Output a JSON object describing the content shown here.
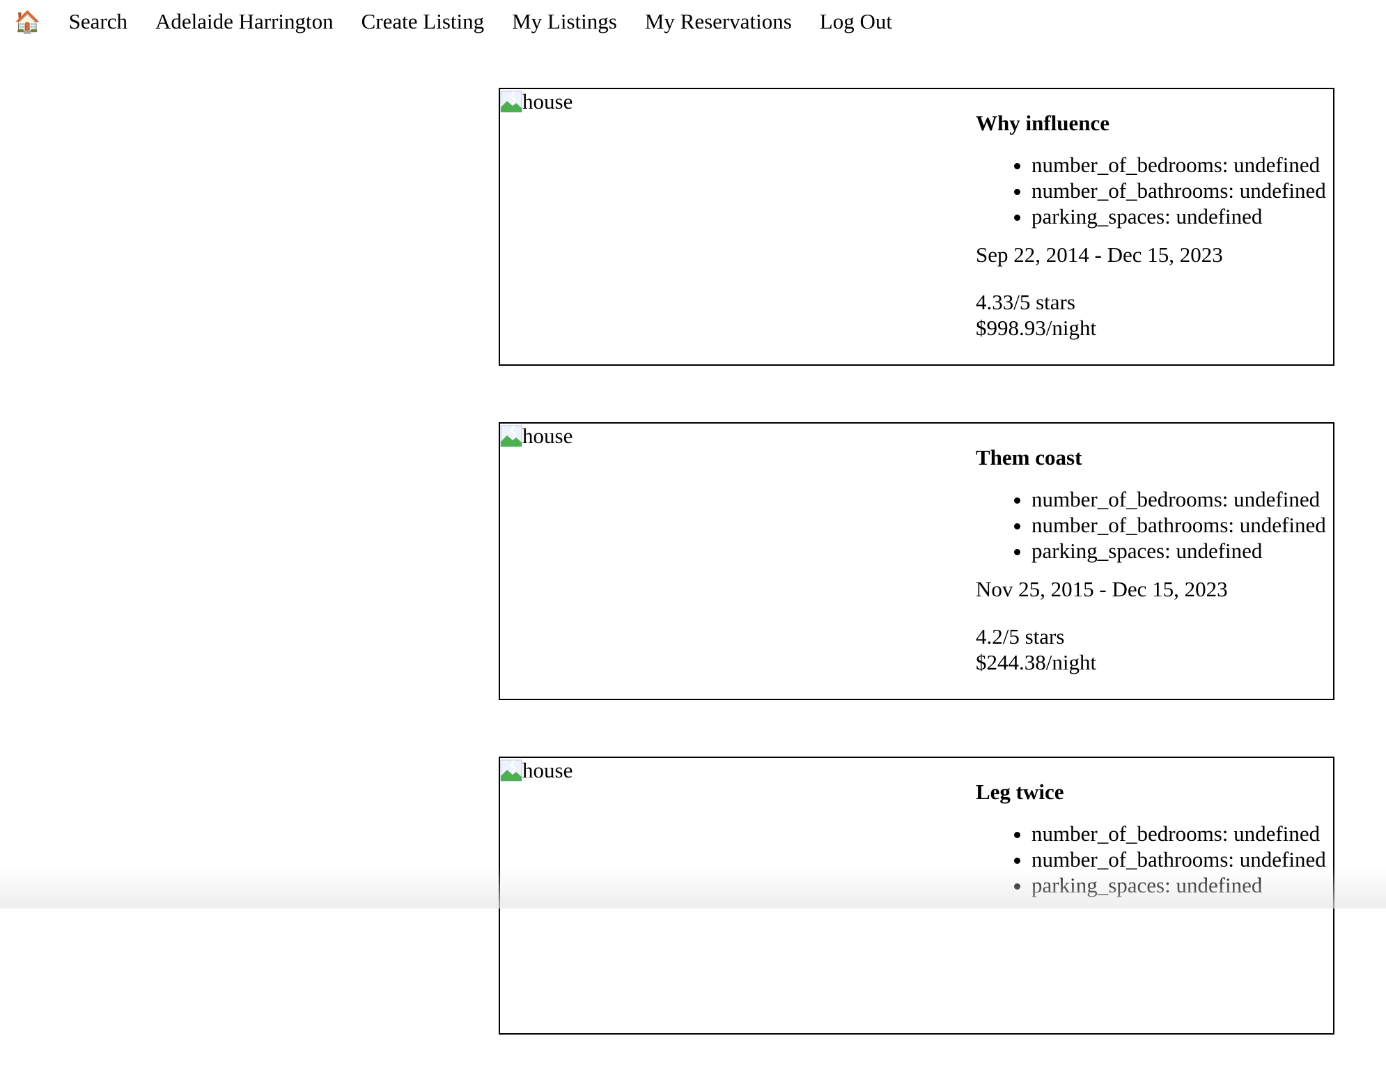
{
  "nav": {
    "home_icon": "🏠",
    "links": [
      {
        "label": "Search"
      },
      {
        "label": "Adelaide Harrington"
      },
      {
        "label": "Create Listing"
      },
      {
        "label": "My Listings"
      },
      {
        "label": "My Reservations"
      },
      {
        "label": "Log Out"
      }
    ]
  },
  "listings": [
    {
      "image_alt": "house",
      "title": "Why influence",
      "specs": [
        "number_of_bedrooms: undefined",
        "number_of_bathrooms: undefined",
        "parking_spaces: undefined"
      ],
      "dates": "Sep 22, 2014 - Dec 15, 2023",
      "rating": "4.33/5 stars",
      "price": "$998.93/night"
    },
    {
      "image_alt": "house",
      "title": "Them coast",
      "specs": [
        "number_of_bedrooms: undefined",
        "number_of_bathrooms: undefined",
        "parking_spaces: undefined"
      ],
      "dates": "Nov 25, 2015 - Dec 15, 2023",
      "rating": "4.2/5 stars",
      "price": "$244.38/night"
    },
    {
      "image_alt": "house",
      "title": "Leg twice",
      "specs": [
        "number_of_bedrooms: undefined",
        "number_of_bathrooms: undefined",
        "parking_spaces: undefined"
      ],
      "dates": "",
      "rating": "",
      "price": ""
    }
  ]
}
